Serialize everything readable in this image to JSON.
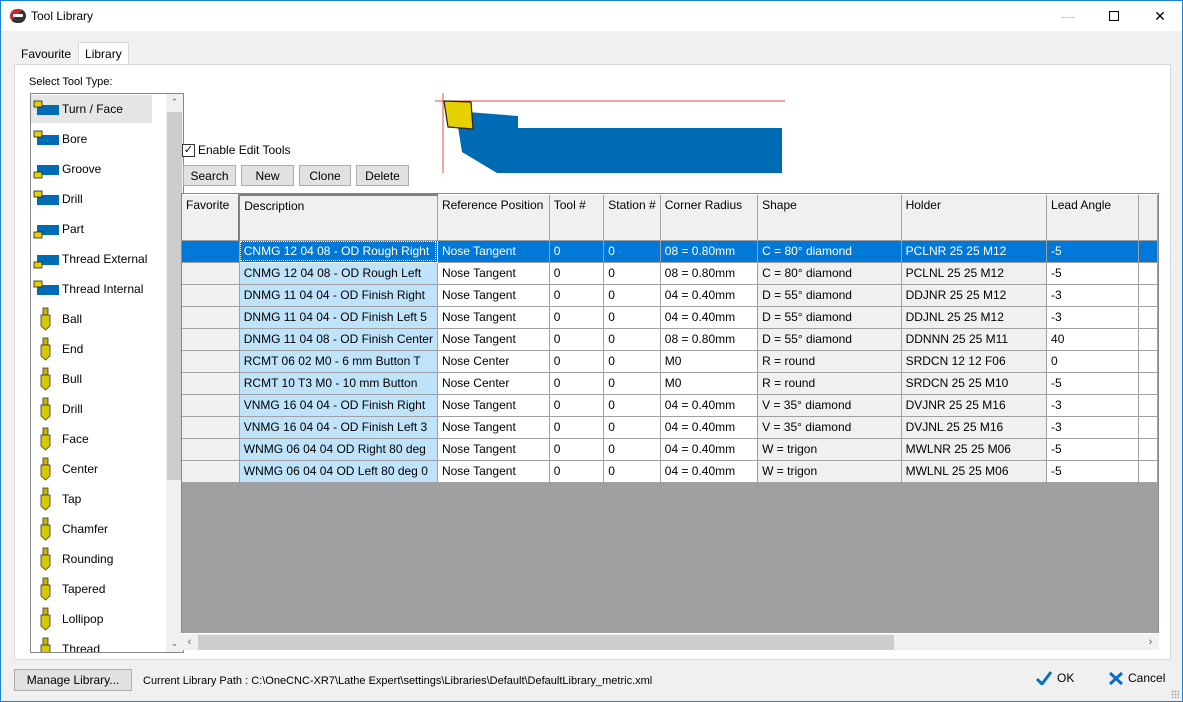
{
  "window": {
    "title": "Tool Library",
    "minimize_icon": "minimize-icon",
    "maximize_icon": "maximize-icon",
    "close_icon": "close-icon"
  },
  "tabs": [
    {
      "label": "Favourite",
      "active": false
    },
    {
      "label": "Library",
      "active": true
    }
  ],
  "tool_types": {
    "label": "Select Tool Type:",
    "selected": "Turn / Face",
    "items": [
      {
        "label": "Turn / Face",
        "icon": "turn-face-icon"
      },
      {
        "label": "Bore",
        "icon": "bore-icon"
      },
      {
        "label": "Groove",
        "icon": "groove-icon"
      },
      {
        "label": "Drill",
        "icon": "lathe-drill-icon"
      },
      {
        "label": "Part",
        "icon": "part-icon"
      },
      {
        "label": "Thread External",
        "icon": "thread-external-icon"
      },
      {
        "label": "Thread Internal",
        "icon": "thread-internal-icon"
      },
      {
        "label": "Ball",
        "icon": "ball-mill-icon"
      },
      {
        "label": "End",
        "icon": "end-mill-icon"
      },
      {
        "label": "Bull",
        "icon": "bull-mill-icon"
      },
      {
        "label": "Drill",
        "icon": "drill-icon"
      },
      {
        "label": "Face",
        "icon": "face-mill-icon"
      },
      {
        "label": "Center",
        "icon": "center-drill-icon"
      },
      {
        "label": "Tap",
        "icon": "tap-icon"
      },
      {
        "label": "Chamfer",
        "icon": "chamfer-icon"
      },
      {
        "label": "Rounding",
        "icon": "rounding-icon"
      },
      {
        "label": "Tapered",
        "icon": "tapered-icon"
      },
      {
        "label": "Lollipop",
        "icon": "lollipop-icon"
      },
      {
        "label": "Thread",
        "icon": "thread-mill-icon"
      }
    ]
  },
  "edit_tools": {
    "enable_label": "Enable Edit Tools",
    "enabled": true,
    "search_label": "Search",
    "new_label": "New",
    "clone_label": "Clone",
    "delete_label": "Delete"
  },
  "table": {
    "columns": [
      "Favorite",
      "Description",
      "Reference Position",
      "Tool #",
      "Station #",
      "Corner Radius",
      "Shape",
      "Holder",
      "Lead Angle"
    ],
    "selected_row": 0,
    "rows": [
      {
        "favorite": "",
        "description": "CNMG 12 04 08 - OD Rough Right",
        "reference": "Nose Tangent",
        "tool": "0",
        "station": "0",
        "radius": "08 = 0.80mm",
        "shape": "C = 80° diamond",
        "holder": "PCLNR 25 25 M12",
        "lead": "-5"
      },
      {
        "favorite": "",
        "description": "CNMG 12 04 08 - OD Rough Left",
        "reference": "Nose Tangent",
        "tool": "0",
        "station": "0",
        "radius": "08 = 0.80mm",
        "shape": "C = 80° diamond",
        "holder": "PCLNL 25 25 M12",
        "lead": "-5"
      },
      {
        "favorite": "",
        "description": "DNMG 11 04 04 - OD Finish Right",
        "reference": "Nose Tangent",
        "tool": "0",
        "station": "0",
        "radius": "04 = 0.40mm",
        "shape": "D = 55° diamond",
        "holder": "DDJNR 25 25 M12",
        "lead": "-3"
      },
      {
        "favorite": "",
        "description": "DNMG 11 04 04 - OD Finish Left 5",
        "reference": "Nose Tangent",
        "tool": "0",
        "station": "0",
        "radius": "04 = 0.40mm",
        "shape": "D = 55° diamond",
        "holder": "DDJNL 25 25 M12",
        "lead": "-3"
      },
      {
        "favorite": "",
        "description": "DNMG 11 04 08 - OD Finish Center",
        "reference": "Nose Tangent",
        "tool": "0",
        "station": "0",
        "radius": "08 = 0.80mm",
        "shape": "D = 55° diamond",
        "holder": "DDNNN 25 25 M11",
        "lead": "40"
      },
      {
        "favorite": "",
        "description": "RCMT 06 02 M0 - 6 mm Button T",
        "reference": "Nose Center",
        "tool": "0",
        "station": "0",
        "radius": "M0",
        "shape": "R = round",
        "holder": "SRDCN 12 12 F06",
        "lead": "0"
      },
      {
        "favorite": "",
        "description": "RCMT 10 T3 M0 - 10 mm Button",
        "reference": "Nose Center",
        "tool": "0",
        "station": "0",
        "radius": "M0",
        "shape": "R = round",
        "holder": "SRDCN 25 25 M10",
        "lead": "-5"
      },
      {
        "favorite": "",
        "description": "VNMG 16 04 04 - OD Finish Right",
        "reference": "Nose Tangent",
        "tool": "0",
        "station": "0",
        "radius": "04 = 0.40mm",
        "shape": "V = 35° diamond",
        "holder": "DVJNR 25 25 M16",
        "lead": "-3"
      },
      {
        "favorite": "",
        "description": "VNMG 16 04 04 - OD Finish Left 3",
        "reference": "Nose Tangent",
        "tool": "0",
        "station": "0",
        "radius": "04 = 0.40mm",
        "shape": "V = 35° diamond",
        "holder": "DVJNL 25 25 M16",
        "lead": "-3"
      },
      {
        "favorite": "",
        "description": "WNMG 06 04 04 OD Right 80 deg",
        "reference": "Nose Tangent",
        "tool": "0",
        "station": "0",
        "radius": "04 = 0.40mm",
        "shape": "W = trigon",
        "holder": "MWLNR 25 25 M06",
        "lead": "-5"
      },
      {
        "favorite": "",
        "description": "WNMG 06 04 04 OD Left 80 deg 0",
        "reference": "Nose Tangent",
        "tool": "0",
        "station": "0",
        "radius": "04 = 0.40mm",
        "shape": "W = trigon",
        "holder": "MWLNL 25 25 M06",
        "lead": "-5"
      }
    ]
  },
  "colors": {
    "selection": "#0078d7",
    "description_column": "#bfe3fb",
    "holder_blue": "#006bb5",
    "insert_yellow": "#e5d000",
    "reference_line": "#e84a4a"
  },
  "footer": {
    "manage_label": "Manage Library...",
    "path_text": "Current Library Path : C:\\OneCNC-XR7\\Lathe Expert\\settings\\Libraries\\Default\\DefaultLibrary_metric.xml",
    "ok_label": "OK",
    "cancel_label": "Cancel"
  }
}
